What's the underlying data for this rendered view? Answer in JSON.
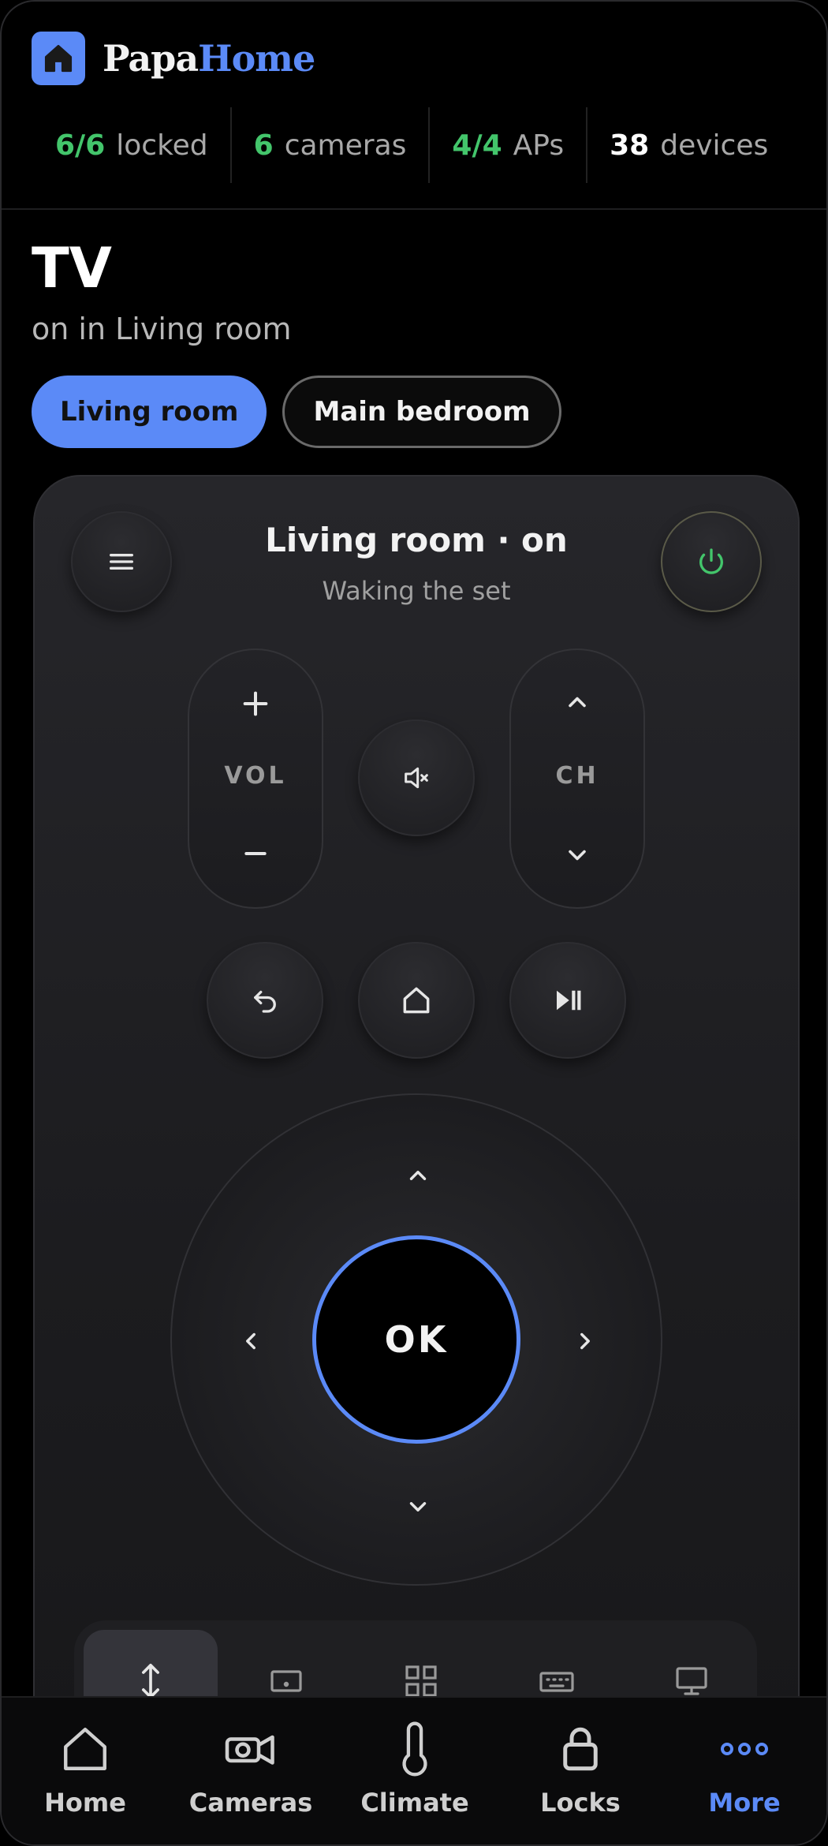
{
  "app": {
    "brand_part1": "Papa",
    "brand_part2": "Home"
  },
  "colors": {
    "accent": "#5b8af7",
    "ok_green": "#43c56b",
    "background": "#000000"
  },
  "stats": [
    {
      "value": "6/6",
      "label": "locked",
      "status": "green"
    },
    {
      "value": "6",
      "label": "cameras",
      "status": "green"
    },
    {
      "value": "4/4",
      "label": "APs",
      "status": "green"
    },
    {
      "value": "38",
      "label": "devices",
      "status": "neutral"
    }
  ],
  "page": {
    "title": "TV",
    "subtitle": "on in Living room"
  },
  "rooms": [
    {
      "label": "Living room",
      "selected": true
    },
    {
      "label": "Main bedroom",
      "selected": false
    }
  ],
  "remote": {
    "title": "Living room · on",
    "status": "Waking the set",
    "vol_label": "VOL",
    "ch_label": "CH",
    "ok_label": "OK",
    "icons": [
      "menu-icon",
      "power-icon",
      "plus-icon",
      "minus-icon",
      "mute-icon",
      "chevron-up-icon",
      "chevron-down-icon",
      "back-icon",
      "home-icon",
      "play-pause-icon"
    ],
    "modes": [
      "swipe-mode-icon",
      "touchpad-icon",
      "apps-grid-icon",
      "keyboard-icon",
      "screen-icon"
    ],
    "selected_mode": "swipe-mode-icon"
  },
  "nav": [
    {
      "label": "Home",
      "icon": "home-icon"
    },
    {
      "label": "Cameras",
      "icon": "camera-icon"
    },
    {
      "label": "Climate",
      "icon": "thermometer-icon"
    },
    {
      "label": "Locks",
      "icon": "lock-icon"
    },
    {
      "label": "More",
      "icon": "more-dots-icon",
      "active": true
    }
  ]
}
